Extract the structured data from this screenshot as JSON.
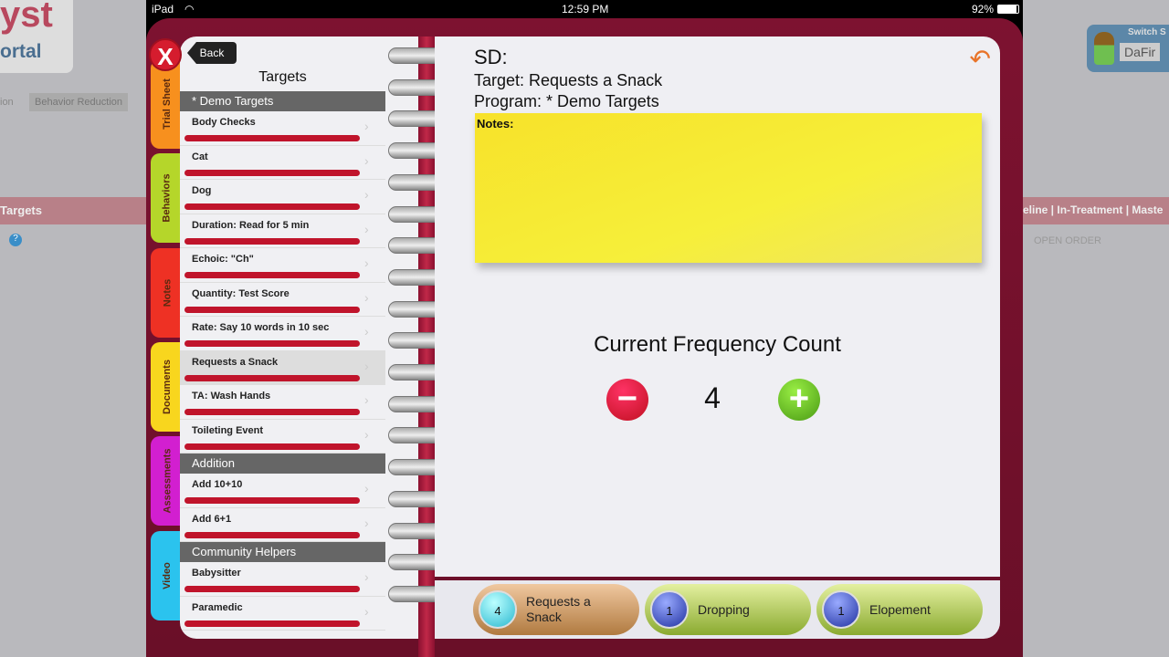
{
  "background": {
    "logo_top": "yst",
    "logo_bottom": "ortal",
    "tab_partial": "ion",
    "tab_behavior": "Behavior Reduction",
    "targets_header": "Targets",
    "status_tabs": "eline | In-Treatment | Maste",
    "open_order": "OPEN ORDER",
    "switch_label": "Switch S",
    "user_name": "DaFir"
  },
  "status_bar": {
    "device": "iPad",
    "time": "12:59 PM",
    "battery": "92%"
  },
  "side_tabs": [
    {
      "label": "Trial Sheet",
      "color": "#f7901e"
    },
    {
      "label": "Behaviors",
      "color": "#b5d62a"
    },
    {
      "label": "Notes",
      "color": "#ee3124"
    },
    {
      "label": "Documents",
      "color": "#f8d61e"
    },
    {
      "label": "Assessments",
      "color": "#d21fd0"
    },
    {
      "label": "Video",
      "color": "#2bc3ee"
    }
  ],
  "close_label": "X",
  "left_page": {
    "back_label": "Back",
    "title": "Targets",
    "sections": [
      {
        "name": "* Demo Targets",
        "items": [
          "Body Checks",
          "Cat",
          "Dog",
          "Duration: Read for 5 min",
          "Echoic: \"Ch\"",
          "Quantity: Test Score",
          "Rate: Say 10 words in 10 sec",
          "Requests a Snack",
          "TA: Wash Hands",
          "Toileting Event"
        ]
      },
      {
        "name": "Addition",
        "items": [
          "Add 10+10",
          "Add 6+1"
        ]
      },
      {
        "name": "Community Helpers",
        "items": [
          "Babysitter",
          "Paramedic"
        ]
      }
    ],
    "selected": "Requests a Snack"
  },
  "right_page": {
    "sd": "SD:",
    "target": "Target: Requests a Snack",
    "program": "Program: * Demo Targets",
    "notes_label": "Notes:",
    "frequency_title": "Current Frequency Count",
    "count": "4",
    "minus_label": "−",
    "plus_label": "+"
  },
  "bottom_bar": [
    {
      "count": "4",
      "label": "Requests a Snack",
      "active": true
    },
    {
      "count": "1",
      "label": "Dropping",
      "active": false
    },
    {
      "count": "1",
      "label": "Elopement",
      "active": false
    }
  ]
}
